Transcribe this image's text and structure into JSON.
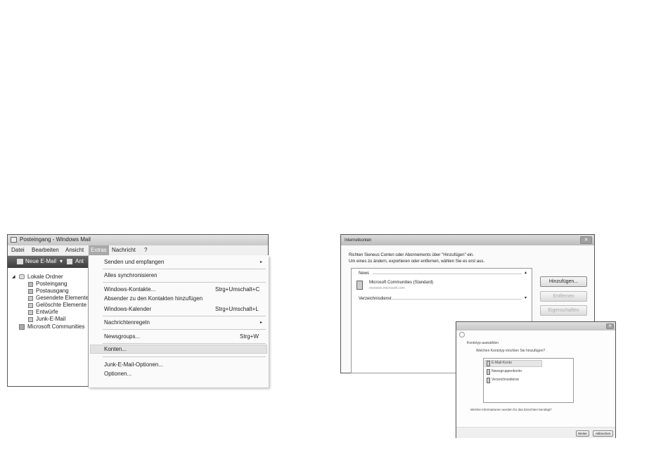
{
  "mail_window": {
    "title": "Posteingang - Windows Mail",
    "menubar": [
      "Datei",
      "Bearbeiten",
      "Ansicht",
      "Extras",
      "Nachricht",
      "?"
    ],
    "toolbar": {
      "new_mail": "Neue E-Mail",
      "next": "Ant"
    },
    "folder_tree": {
      "root": "Lokale Ordner",
      "folders": [
        "Posteingang",
        "Postausgang",
        "Gesendete Elemente",
        "Gelöschte Elemente",
        "Entwürfe",
        "Junk-E-Mail"
      ],
      "account": "Microsoft Communities"
    },
    "extras_menu": {
      "send_receive": "Senden und empfangen",
      "sync_all": "Alles synchronisieren",
      "contacts": "Windows-Kontakte...",
      "contacts_shortcut": "Strg+Umschalt+C",
      "add_sender": "Absender zu den Kontakten hinzufügen",
      "calendar": "Windows-Kalender",
      "calendar_shortcut": "Strg+Umschalt+L",
      "rules": "Nachrichtenregeln",
      "newsgroups": "Newsgroups...",
      "newsgroups_shortcut": "Strg+W",
      "accounts": "Konten...",
      "junk_options": "Junk-E-Mail-Optionen...",
      "options": "Optionen..."
    }
  },
  "accounts_dialog": {
    "title": "Internetkonten",
    "instruction_1": "Richten Sieneus Conten oder Abonnements über \"Hinzufügen\" ein.",
    "instruction_2": "Um eines zu ändern, exportieren oder entfernen, wählen Sie es erst aus.",
    "section_news": "News",
    "account_name": "Microsoft Communities (Standard)",
    "account_server": "msnews.microsoft.com",
    "section_dir": "Verzeichnisdienst",
    "buttons": {
      "add": "Hinzufügen...",
      "remove": "Entfernen",
      "properties": "Eigenschaften"
    }
  },
  "select_dialog": {
    "title": "Kontotyp auswählen",
    "prompt": "Welchen Kontotyp möchten Sie hinzufügen?",
    "options": [
      "E-Mail-Konto",
      "Newsgruppenkonto",
      "Verzeichnisdienst"
    ],
    "link": "Welche Informationen werden für das Einrichten benötigt?",
    "buttons": {
      "next": "Weiter",
      "cancel": "Abbrechen"
    }
  },
  "colors": {
    "title_bar": "#c8c8c8",
    "highlight": "#d8d8d8",
    "menu_bg": "#fafafa",
    "border": "#555555"
  }
}
